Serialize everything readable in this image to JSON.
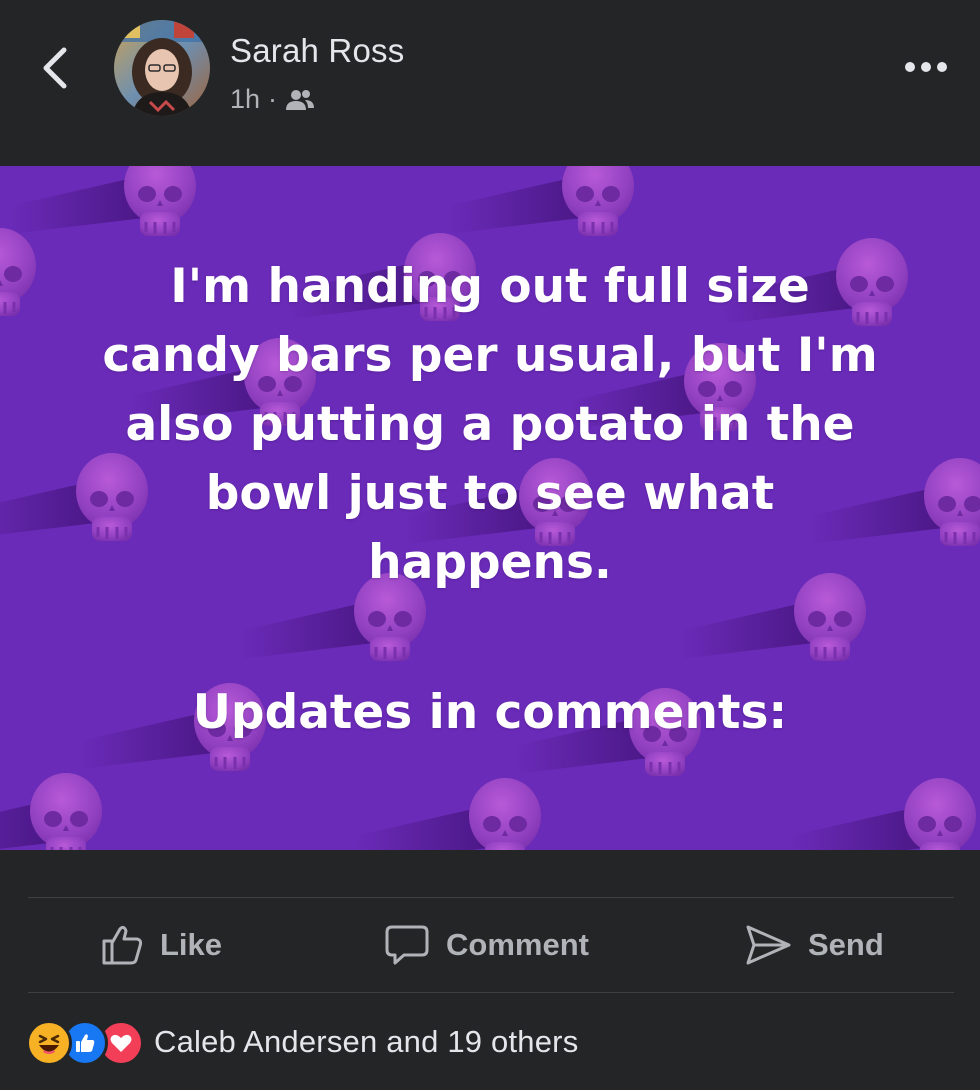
{
  "header": {
    "author_name": "Sarah Ross",
    "time": "1h",
    "separator": "·",
    "audience_icon": "friends-icon",
    "back_icon": "chevron-left-icon",
    "more_icon": "more-horizontal-icon"
  },
  "post": {
    "text": "I'm handing out full size\ncandy bars per usual, but I'm\nalso putting a potato in the\nbowl just to see what\nhappens.",
    "updates_line": "Updates in comments:",
    "background_color": "#6a2bb8",
    "text_color": "#ffffff"
  },
  "actions": {
    "like_label": "Like",
    "comment_label": "Comment",
    "send_label": "Send",
    "like_icon": "thumbs-up-outline-icon",
    "comment_icon": "speech-bubble-icon",
    "send_icon": "paper-plane-icon"
  },
  "reactions": {
    "summary": "Caleb Andersen and 19 others",
    "types": [
      "haha",
      "like",
      "love"
    ]
  },
  "colors": {
    "surface": "#242526",
    "text_primary": "#e4e6eb",
    "text_secondary": "#b0b3b8",
    "like_blue": "#1877f2",
    "love_red": "#f33e58",
    "haha_yellow": "#f7b125"
  }
}
